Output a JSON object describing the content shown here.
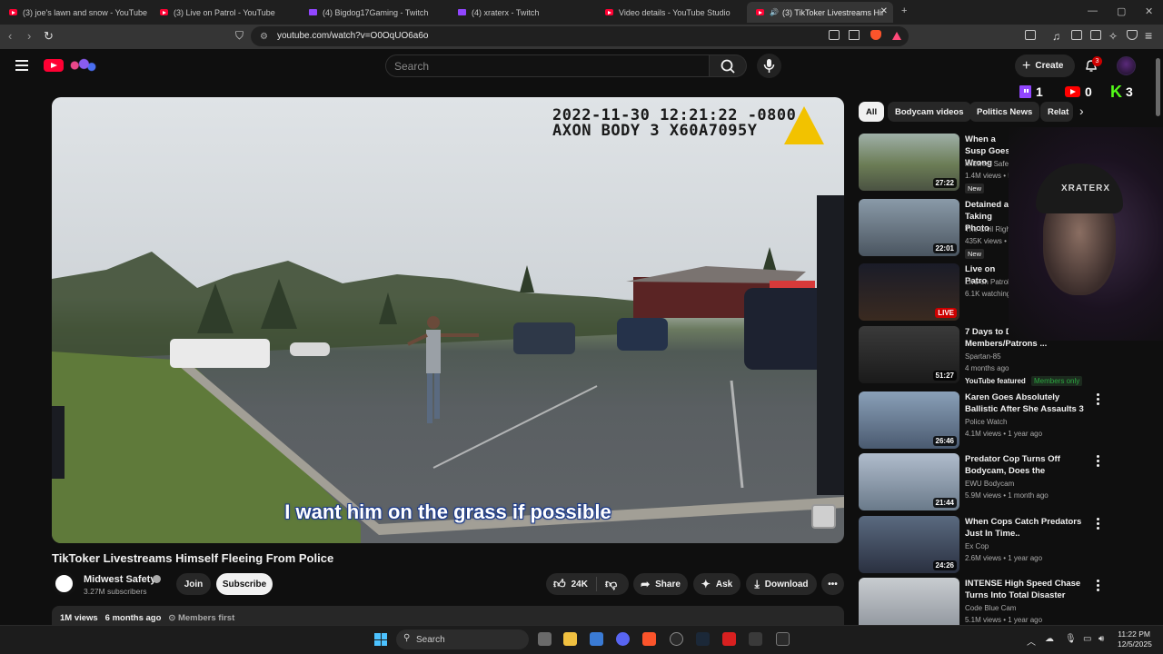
{
  "browser": {
    "tabs": [
      {
        "title": "(3) joe's lawn and snow - YouTube",
        "type": "yt"
      },
      {
        "title": "(3) Live on Patrol - YouTube",
        "type": "yt"
      },
      {
        "title": "(4) Bigdog17Gaming - Twitch",
        "type": "tw"
      },
      {
        "title": "(4) xraterx - Twitch",
        "type": "tw"
      },
      {
        "title": "Video details - YouTube Studio",
        "type": "yt"
      },
      {
        "title": "(3) TikToker Livestreams Himse",
        "type": "yt"
      }
    ],
    "new_tab": "+",
    "url": "youtube.com/watch?v=O0OqUO6a6o",
    "window_min": "—",
    "window_max": "▢",
    "window_close": "✕"
  },
  "header": {
    "search_placeholder": "Search",
    "create_label": "Create",
    "notification_count": "3"
  },
  "stream_counters": {
    "twitch": "1",
    "youtube": "0",
    "kick": "3",
    "kick_glyph": "K"
  },
  "video": {
    "timestamp_line1": "2022-11-30 12:21:22 -0800",
    "timestamp_line2": "AXON BODY 3 X60A7095Y",
    "subtitle": "I want him on the grass if possible",
    "title": "TikToker Livestreams Himself Fleeing From Police",
    "channel": "Midwest Safety",
    "subscribers": "3.27M subscribers",
    "join": "Join",
    "subscribe": "Subscribe",
    "likes": "24K",
    "share": "Share",
    "ask": "Ask",
    "download": "Download",
    "desc_views": "1M views",
    "desc_age": "6 months ago",
    "desc_members": "Members first"
  },
  "chips": [
    "All",
    "Bodycam videos",
    "Politics News",
    "Relat"
  ],
  "recommendations": [
    {
      "title": "When a Susp Goes Wrong",
      "channel": "Midwest Safet",
      "meta": "1.4M views • 5",
      "badge": "New",
      "duration": "27:22",
      "live": false
    },
    {
      "title": "Detained as Taking Photo",
      "channel": "The Civil Right",
      "meta": "435K views • 1",
      "badge": "New",
      "duration": "22:01",
      "live": false
    },
    {
      "title": "Live on Patro",
      "channel": "Live on Patrol",
      "meta": "6.1K watching",
      "badge": "",
      "duration": "LIVE",
      "live": true
    },
    {
      "title": "7 Days to Di Guy\" (Ep 5) Members/Patrons ...",
      "channel": "Spartan-85",
      "meta": "4 months ago",
      "badge": "",
      "duration": "51:27",
      "live": false,
      "featured": "YouTube featured",
      "members": "Members only"
    },
    {
      "title": "Karen Goes Absolutely Ballistic After She Assaults 3 Flight ...",
      "channel": "Police Watch",
      "meta": "4.1M views • 1 year ago",
      "badge": "",
      "duration": "26:46",
      "live": false
    },
    {
      "title": "Predator Cop Turns Off Bodycam, Does the Unthinkable",
      "channel": "EWU Bodycam",
      "meta": "5.9M views • 1 month ago",
      "badge": "",
      "duration": "21:44",
      "live": false
    },
    {
      "title": "When Cops Catch Predators Just In Time..",
      "channel": "Ex Cop",
      "meta": "2.6M views • 1 year ago",
      "badge": "",
      "duration": "24:26",
      "live": false
    },
    {
      "title": "INTENSE High Speed Chase Turns Into Total Disaster",
      "channel": "Code Blue Cam",
      "meta": "5.1M views • 1 year ago",
      "badge": "",
      "duration": "",
      "live": false
    }
  ],
  "webcam": {
    "overlay_text": "XRATERX"
  },
  "taskbar": {
    "search_label": "Search",
    "time": "11:22 PM",
    "date": "12/5/2025"
  },
  "colors": {
    "youtube_red": "#ff0033",
    "twitch_purple": "#9146ff",
    "kick_green": "#53fc18",
    "background": "#0f0f0f"
  }
}
